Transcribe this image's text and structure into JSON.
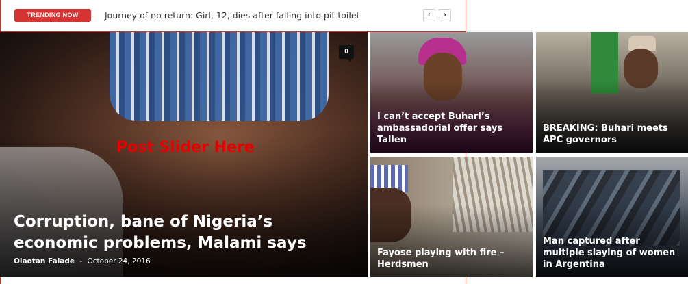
{
  "trending": {
    "badge": "TRENDING NOW",
    "headline": "Journey of no return: Girl, 12, dies after falling into pit toilet",
    "prev_icon": "‹",
    "next_icon": "›"
  },
  "featured": {
    "placeholder": "Post Slider Here",
    "comment_count": "0",
    "title": "Corruption, bane of Nigeria’s economic problems, Malami says",
    "author": "Olaotan Falade",
    "separator": "-",
    "date": "October 24, 2016"
  },
  "tiles": [
    {
      "title": "I can’t accept Buhari’s ambassadorial offer says Tallen"
    },
    {
      "title": "BREAKING: Buhari meets APC governors"
    },
    {
      "title": "Fayose playing with fire – Herdsmen"
    },
    {
      "title": "Man captured after multiple slaying of women in Argentina"
    }
  ],
  "colors": {
    "badge": "#d63333",
    "guide_line": "#c0392b",
    "placeholder_text": "#e60000"
  }
}
